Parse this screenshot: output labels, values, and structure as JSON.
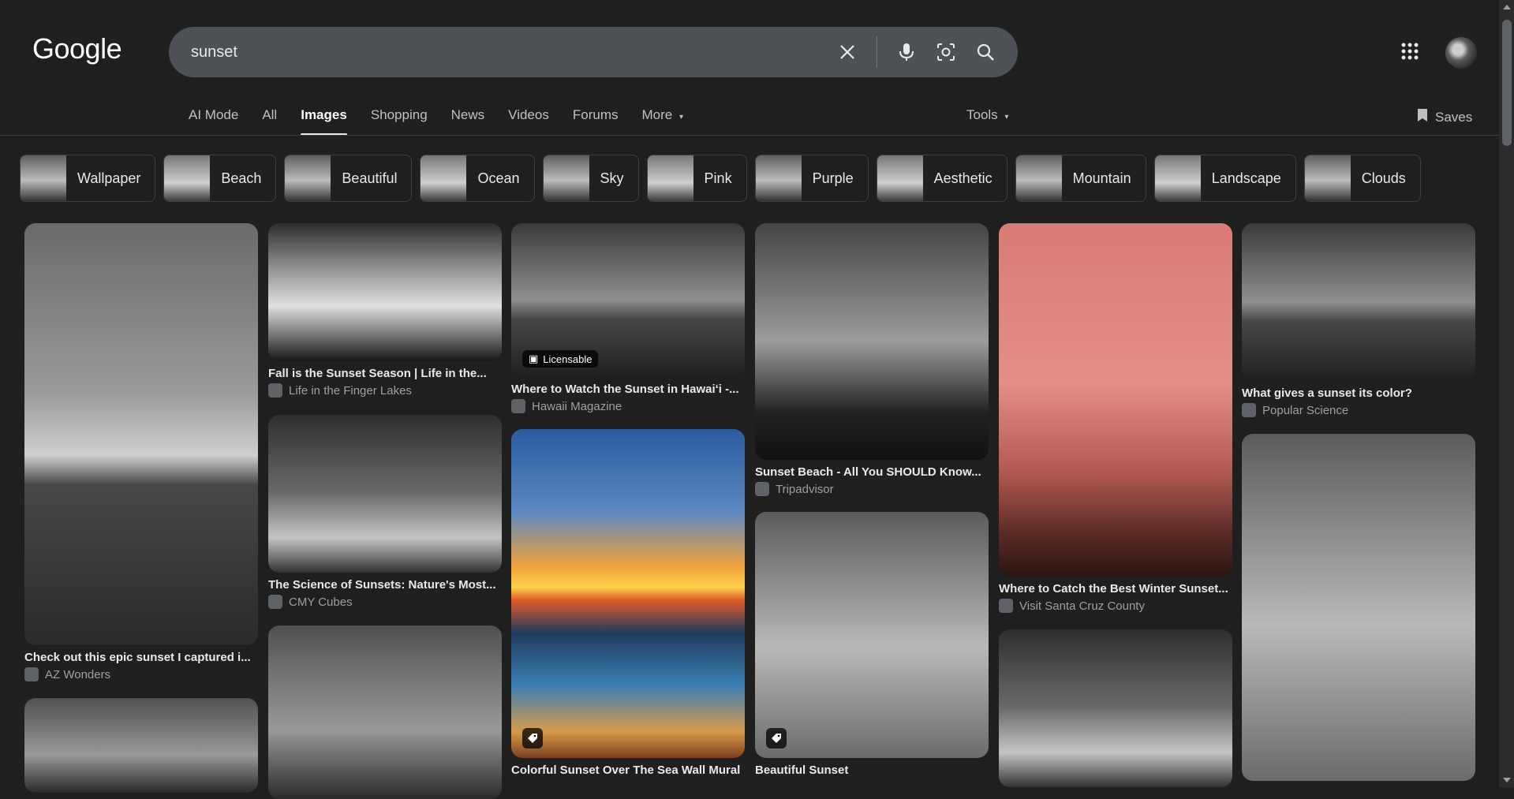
{
  "header": {
    "logo": "Google",
    "search": {
      "value": "sunset",
      "placeholder": ""
    },
    "icons": [
      "clear-icon",
      "mic-icon",
      "lens-icon",
      "search-icon",
      "apps-grid-icon"
    ]
  },
  "tabs": [
    {
      "label": "AI Mode"
    },
    {
      "label": "All"
    },
    {
      "label": "Images"
    },
    {
      "label": "Shopping"
    },
    {
      "label": "News"
    },
    {
      "label": "Videos"
    },
    {
      "label": "Forums"
    },
    {
      "label": "More"
    }
  ],
  "tools_label": "Tools",
  "saves_label": "Saves",
  "chips": [
    {
      "label": "Wallpaper"
    },
    {
      "label": "Beach"
    },
    {
      "label": "Beautiful"
    },
    {
      "label": "Ocean"
    },
    {
      "label": "Sky"
    },
    {
      "label": "Pink"
    },
    {
      "label": "Purple"
    },
    {
      "label": "Aesthetic"
    },
    {
      "label": "Mountain"
    },
    {
      "label": "Landscape"
    },
    {
      "label": "Clouds"
    }
  ],
  "results": [
    {
      "title": "Check out this epic sunset I captured i...",
      "source": "AZ Wonders"
    },
    {
      "title": "Fall is the Sunset Season | Life in the...",
      "source": "Life in the Finger Lakes"
    },
    {
      "title": "The Science of Sunsets: Nature's Most...",
      "source": "CMY Cubes"
    },
    {
      "title": "Where to Watch the Sunset in Hawaiʻi -...",
      "source": "Hawaii Magazine",
      "badge": "Licensable"
    },
    {
      "title": "Colorful Sunset Over The Sea Wall Mural",
      "source": ""
    },
    {
      "title": "Sunset Beach - All You SHOULD Know...",
      "source": "Tripadvisor"
    },
    {
      "title": "Beautiful Sunset",
      "source": ""
    },
    {
      "title": "Where to Catch the Best Winter Sunset...",
      "source": "Visit Santa Cruz County"
    },
    {
      "title": "What gives a sunset its color?",
      "source": "Popular Science"
    }
  ]
}
